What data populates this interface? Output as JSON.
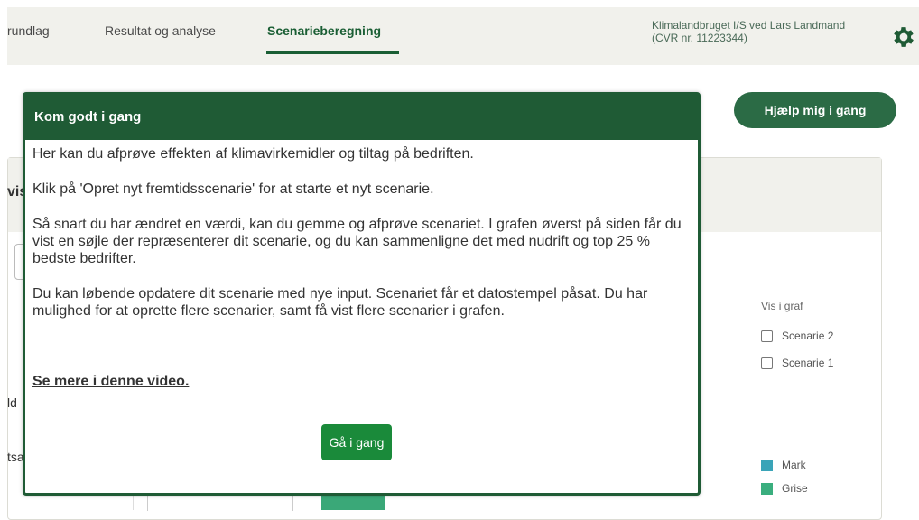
{
  "nav": {
    "tabs": [
      {
        "label": "rundlag"
      },
      {
        "label": "Resultat og analyse"
      },
      {
        "label": "Scenarieberegning"
      }
    ],
    "active_tab": "Scenarieberegning",
    "company_line1": "Klimalandbruget I/S ved Lars Landmand",
    "company_line2": "(CVR nr. 11223344)",
    "settings_icon": "gear-icon"
  },
  "help_button_label": "Hjælp mig i gang",
  "background": {
    "vis_fragment": "vis",
    "ld_fragment": "ld",
    "tsa_fragment": "tsa",
    "graph_label": "Vis i graf",
    "scenarios": [
      {
        "label": "Scenarie 2",
        "checked": false
      },
      {
        "label": "Scenarie 1",
        "checked": false
      }
    ],
    "legend": [
      {
        "label": "Mark",
        "color": "#3aa4b8"
      },
      {
        "label": "Grise",
        "color": "#3aae7e"
      }
    ]
  },
  "modal": {
    "title": "Kom godt i gang",
    "paragraphs": [
      "Her kan du afprøve effekten af klimavirkemidler og tiltag på bedriften.",
      "Klik på 'Opret nyt fremtidsscenarie' for at starte et nyt scenarie.",
      "Så snart du har ændret en værdi, kan du gemme og afprøve scenariet. I grafen øverst på siden får du vist en søjle der repræsenterer dit scenarie, og du kan sammenligne det med nudrift og top 25 % bedste bedrifter.",
      "Du kan løbende opdatere dit scenarie med nye input. Scenariet får et datostempel påsat. Du har mulighed for at oprette flere scenarier, samt få vist flere scenarier i grafen."
    ],
    "video_link": "Se mere i denne video.",
    "go_button": "Gå i gang"
  },
  "colors": {
    "primary_green": "#1f5b35",
    "button_green": "#1a8a3a",
    "help_green": "#2b6b45"
  }
}
